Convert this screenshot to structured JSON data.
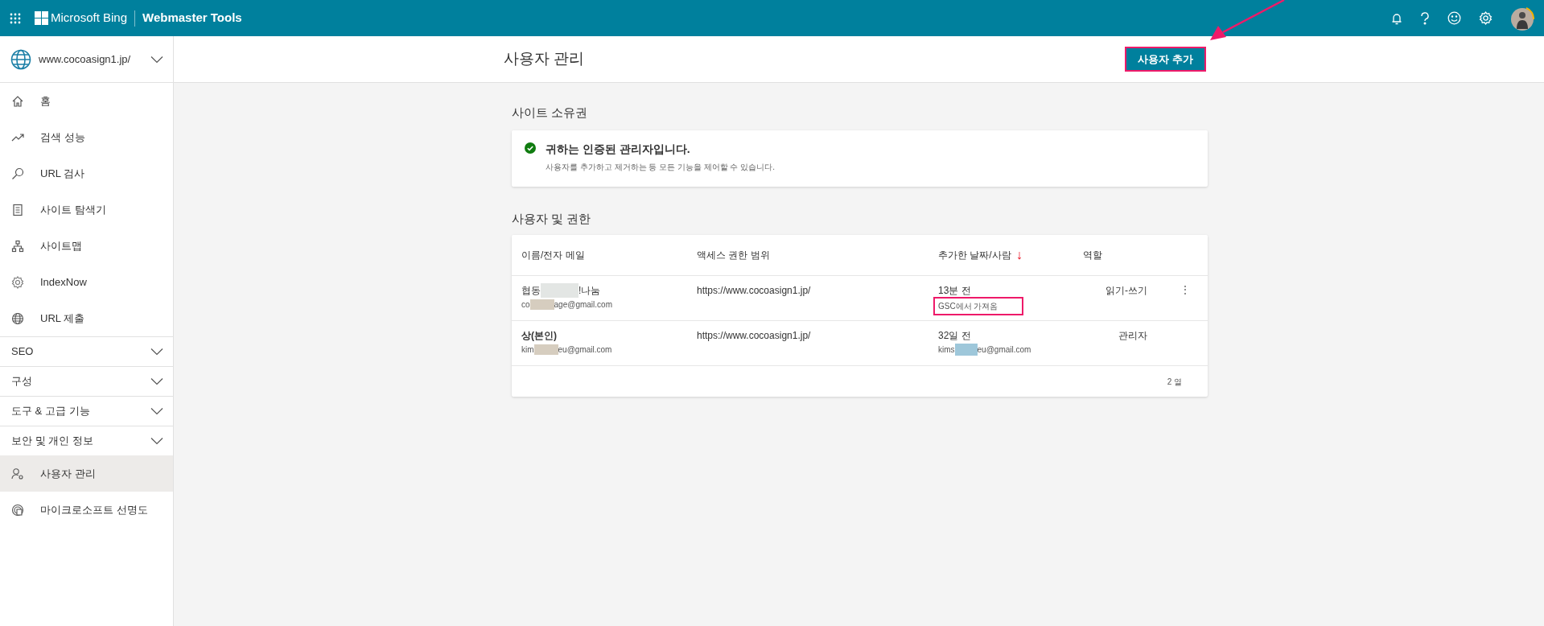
{
  "top_bar": {
    "brand": "Microsoft Bing",
    "product": "Webmaster Tools"
  },
  "sidebar": {
    "site": "www.cocoasign1.jp/",
    "items": [
      {
        "kind": "link",
        "label": "홈",
        "selected": false
      },
      {
        "kind": "link",
        "label": "검색 성능",
        "selected": false
      },
      {
        "kind": "link",
        "label": "URL 검사",
        "selected": false
      },
      {
        "kind": "link",
        "label": "사이트 탐색기",
        "selected": false
      },
      {
        "kind": "link",
        "label": "사이트맵",
        "selected": false
      },
      {
        "kind": "link",
        "label": "IndexNow",
        "selected": false
      },
      {
        "kind": "link",
        "label": "URL 제출",
        "selected": false
      },
      {
        "kind": "group",
        "label": "SEO",
        "expanded": false
      },
      {
        "kind": "group",
        "label": "구성",
        "expanded": false
      },
      {
        "kind": "group",
        "label": "도구 & 고급 기능",
        "expanded": false
      },
      {
        "kind": "group",
        "label": "보안 및 개인 정보",
        "expanded": false
      },
      {
        "kind": "link",
        "label": "사용자 관리",
        "selected": true
      },
      {
        "kind": "link",
        "label": "마이크로소프트 선명도",
        "selected": false
      }
    ]
  },
  "header": {
    "title": "사용자 관리",
    "add_button": "사용자 추가"
  },
  "ownership": {
    "heading": "사이트 소유권",
    "status": "귀하는 인증된 관리자입니다.",
    "detail": "사용자를 추가하고 제거하는 등 모든 기능을 제어할 수 있습니다."
  },
  "users": {
    "heading": "사용자 및 권한",
    "columns": [
      "이름/전자 메일",
      "액세스 권한 범위",
      "추가한 날짜/사람",
      "역할"
    ],
    "sort_indicator": "↓",
    "rows": [
      {
        "name_start": "협동",
        "name_end": "!나눔",
        "email_start": "co",
        "email_end": "age@gmail.com",
        "scope": "https://www.cocoasign1.jp/",
        "added": "13분 전",
        "added_by": "GSC에서 가져옴",
        "kind": "imported",
        "role": "읽기-쓰기",
        "menu": "⋮"
      },
      {
        "name_start": "상",
        "name_end": "(본인)",
        "email_start": "kim",
        "email_end": "eu@gmail.com",
        "scope": "https://www.cocoasign1.jp/",
        "added": "32일 전",
        "added_by": "kims",
        "added_by_end": "eu@gmail.com",
        "kind": "invited",
        "role": "관리자"
      }
    ],
    "count": "2 열"
  }
}
